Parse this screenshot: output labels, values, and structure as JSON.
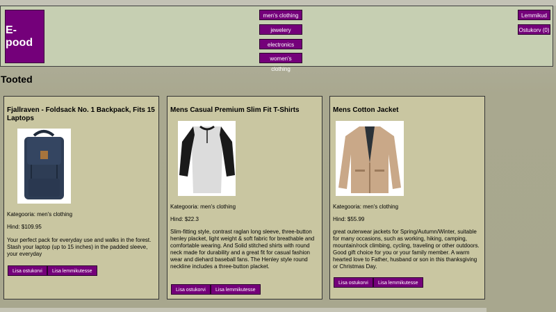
{
  "header": {
    "logo": "E-pood",
    "nav": [
      "men's clothing",
      "jewelery",
      "electronics",
      "women's clothing"
    ],
    "favorites": "Lemmikud",
    "cart": "Ostukorv (0)"
  },
  "page_title": "Tooted",
  "products": [
    {
      "title": "Fjallraven - Foldsack No. 1 Backpack, Fits 15 Laptops",
      "category": "Kategooria: men's clothing",
      "price": "Hind: $109.95",
      "description": "Your perfect pack for everyday use and walks in the forest. Stash your laptop (up to 15 inches) in the padded sleeve, your everyday",
      "add_cart": "Lisa ostukorvi",
      "add_fav": "Lisa lemmikutesse",
      "image": "backpack"
    },
    {
      "title": "Mens Casual Premium Slim Fit T-Shirts",
      "category": "Kategooria: men's clothing",
      "price": "Hind: $22.3",
      "description": "Slim-fitting style, contrast raglan long sleeve, three-button henley placket, light weight & soft fabric for breathable and comfortable wearing. And Solid stitched shirts with round neck made for durability and a great fit for casual fashion wear and diehard baseball fans. The Henley style round neckline includes a three-button placket.",
      "add_cart": "Lisa ostukorvi",
      "add_fav": "Lisa lemmikutesse",
      "image": "raglan-tshirt"
    },
    {
      "title": "Mens Cotton Jacket",
      "category": "Kategooria: men's clothing",
      "price": "Hind: $55.99",
      "description": "great outerwear jackets for Spring/Autumn/Winter, suitable for many occasions, such as working, hiking, camping, mountain/rock climbing, cycling, traveling or other outdoors. Good gift choice for you or your family member. A warm hearted love to Father, husband or son in this thanksgiving or Christmas Day.",
      "add_cart": "Lisa ostukorvi",
      "add_fav": "Lisa lemmikutesse",
      "image": "cotton-jacket"
    }
  ]
}
